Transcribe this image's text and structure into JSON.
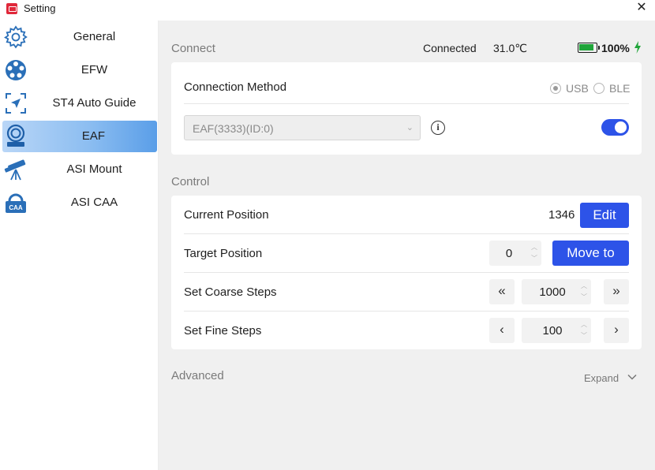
{
  "window": {
    "title": "Setting"
  },
  "sidebar": {
    "items": [
      {
        "label": "General",
        "icon": "gear-icon"
      },
      {
        "label": "EFW",
        "icon": "filter-wheel-icon"
      },
      {
        "label": "ST4 Auto Guide",
        "icon": "guide-arrow-icon"
      },
      {
        "label": "EAF",
        "icon": "focuser-icon"
      },
      {
        "label": "ASI Mount",
        "icon": "telescope-icon"
      },
      {
        "label": "ASI CAA",
        "icon": "caa-icon"
      }
    ],
    "active": "EAF"
  },
  "connect": {
    "section_title": "Connect",
    "status": "Connected",
    "temperature": "31.0℃",
    "battery": "100%",
    "battery_level": 1.0,
    "method_label": "Connection Method",
    "options": [
      "USB",
      "BLE"
    ],
    "selected_option": "USB",
    "device": "EAF(3333)(ID:0)",
    "toggle_on": true
  },
  "control": {
    "section_title": "Control",
    "current_position_label": "Current Position",
    "current_position": "1346",
    "edit_label": "Edit",
    "target_position_label": "Target Position",
    "target_position": "0",
    "move_to_label": "Move to",
    "coarse_label": "Set Coarse Steps",
    "coarse_steps": "1000",
    "fine_label": "Set Fine Steps",
    "fine_steps": "100"
  },
  "advanced": {
    "section_title": "Advanced",
    "expand_label": "Expand"
  },
  "colors": {
    "accent": "#2d53e8",
    "battery_green": "#20a53a",
    "active_nav": "#5a9ee8",
    "panel_bg": "#f0f0f0"
  }
}
